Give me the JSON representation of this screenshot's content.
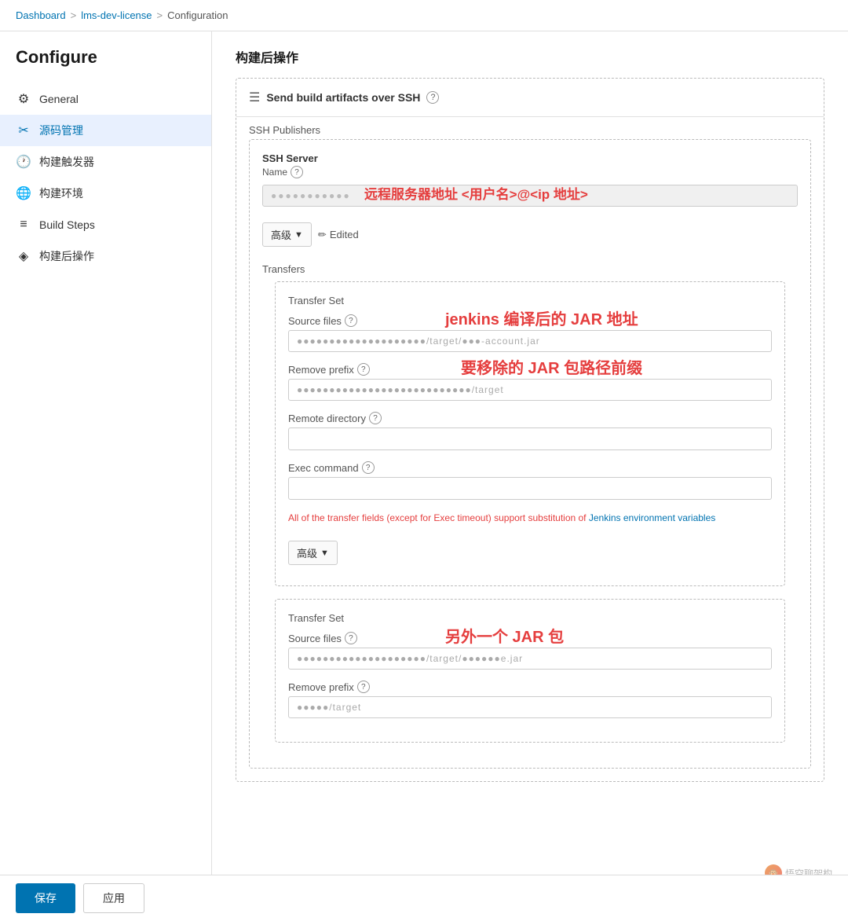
{
  "breadcrumb": {
    "items": [
      "Dashboard",
      "lms-dev-license",
      "Configuration"
    ],
    "separators": [
      ">",
      ">"
    ]
  },
  "sidebar": {
    "title": "Configure",
    "items": [
      {
        "id": "general",
        "label": "General",
        "icon": "⚙",
        "active": false
      },
      {
        "id": "source",
        "label": "源码管理",
        "icon": "✂",
        "active": true
      },
      {
        "id": "triggers",
        "label": "构建触发器",
        "icon": "🕐",
        "active": false
      },
      {
        "id": "env",
        "label": "构建环境",
        "icon": "🌐",
        "active": false
      },
      {
        "id": "build-steps",
        "label": "Build Steps",
        "icon": "≡",
        "active": false
      },
      {
        "id": "post-build",
        "label": "构建后操作",
        "icon": "◈",
        "active": false
      }
    ]
  },
  "main": {
    "section_title": "构建后操作",
    "card": {
      "header_icon": "☰",
      "header_title": "Send build artifacts over SSH",
      "ssh_publishers_label": "SSH Publishers",
      "ssh_server": {
        "label": "SSH Server",
        "sublabel": "Name",
        "help": "?",
        "annotation": "远程服务器地址 <用户名>@<ip 地址>",
        "blurred_value": "●●●●●●●●●●●●"
      },
      "advanced_btn": "高级",
      "edited_label": "Edited",
      "transfers_label": "Transfers",
      "transfer_sets": [
        {
          "label": "Transfer Set",
          "source_files_label": "Source files",
          "annotation_source": "jenkins 编译后的 JAR 地址",
          "source_value": "●●●●●●●●●●●●●●●●●●●●/target/●●●-account.jar",
          "remove_prefix_label": "Remove prefix",
          "annotation_prefix": "要移除的 JAR 包路径前缀",
          "prefix_value": "●●●●●●●●●●●●●●●●●●●●●●●●●●●/target",
          "remote_dir_label": "Remote directory",
          "remote_dir_value": "",
          "exec_cmd_label": "Exec command",
          "exec_cmd_value": "",
          "info_text_prefix": "All of the transfer fields (except for Exec timeout) support substitution of ",
          "info_link": "Jenkins environment variables",
          "advanced_btn": "高级"
        },
        {
          "label": "Transfer Set",
          "source_files_label": "Source files",
          "annotation_source": "另外一个 JAR 包",
          "source_value": "●●●●●●●●●●●●●●●●●●●●/target/●●●●●●e.jar",
          "remove_prefix_label": "Remove prefix",
          "prefix_value": "●●●●●/target"
        }
      ]
    }
  },
  "footer": {
    "save_label": "保存",
    "apply_label": "应用"
  },
  "watermark": {
    "text": "悟空聊架构"
  }
}
